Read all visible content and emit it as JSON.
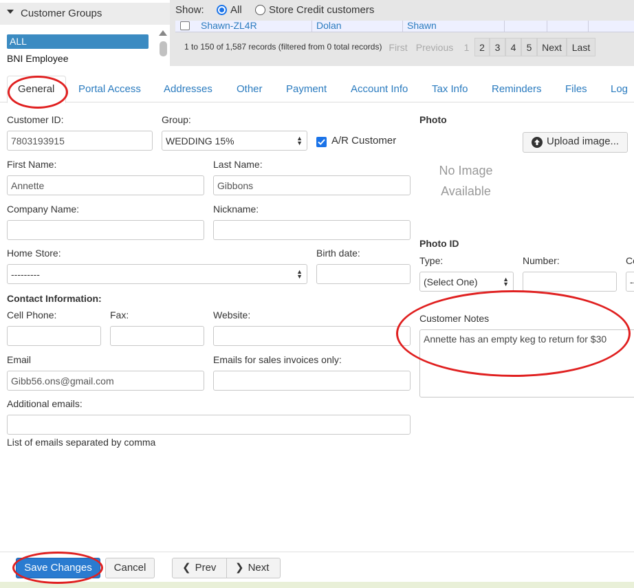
{
  "groups": {
    "title": "Customer Groups",
    "items": [
      "ALL",
      "BNI Employee"
    ]
  },
  "filter": {
    "show_label": "Show:",
    "option_all": "All",
    "option_store_credit": "Store Credit customers",
    "selected": "All"
  },
  "table": {
    "row": [
      "Shawn-ZL4R",
      "Dolan",
      "Shawn"
    ],
    "records_info": "1 to 150 of 1,587 records (filtered from 0 total records)",
    "pager": [
      "First",
      "Previous",
      "1",
      "2",
      "3",
      "4",
      "5",
      "Next",
      "Last"
    ],
    "current_page": "1"
  },
  "tabs": [
    "General",
    "Portal Access",
    "Addresses",
    "Other",
    "Payment",
    "Account Info",
    "Tax Info",
    "Reminders",
    "Files",
    "Log"
  ],
  "active_tab": "General",
  "form": {
    "customer_id_label": "Customer ID:",
    "customer_id": "7803193915",
    "group_label": "Group:",
    "group_value": "WEDDING 15%",
    "ar_customer_label": "A/R Customer",
    "ar_customer_checked": true,
    "first_name_label": "First Name:",
    "first_name": "Annette",
    "last_name_label": "Last Name:",
    "last_name": "Gibbons",
    "company_name_label": "Company Name:",
    "company_name": "",
    "nickname_label": "Nickname:",
    "nickname": "",
    "home_store_label": "Home Store:",
    "home_store": "---------",
    "birth_date_label": "Birth date:",
    "birth_date": "",
    "contact_heading": "Contact Information:",
    "cell_phone_label": "Cell Phone:",
    "fax_label": "Fax:",
    "website_label": "Website:",
    "email_label": "Email",
    "email": "Gibb56.ons@gmail.com",
    "emails_sales_label": "Emails for sales invoices only:",
    "additional_emails_label": "Additional emails:",
    "additional_emails_hint": "List of emails separated by comma"
  },
  "photo": {
    "heading": "Photo",
    "upload_label": "Upload image...",
    "no_image_line1": "No Image",
    "no_image_line2": "Available"
  },
  "photo_id": {
    "heading": "Photo ID",
    "type_label": "Type:",
    "type_value": "(Select One)",
    "number_label": "Number:",
    "third_label_partial": "Co",
    "third_value_partial": "--"
  },
  "notes": {
    "label": "Customer Notes",
    "text": "Annette has an empty keg to return for $30"
  },
  "actions": {
    "save": "Save Changes",
    "cancel": "Cancel",
    "prev": "Prev",
    "next": "Next"
  },
  "colors": {
    "link": "#2a7bbf",
    "primary_button": "#2a7bd0",
    "annotation_red": "#e02020"
  }
}
